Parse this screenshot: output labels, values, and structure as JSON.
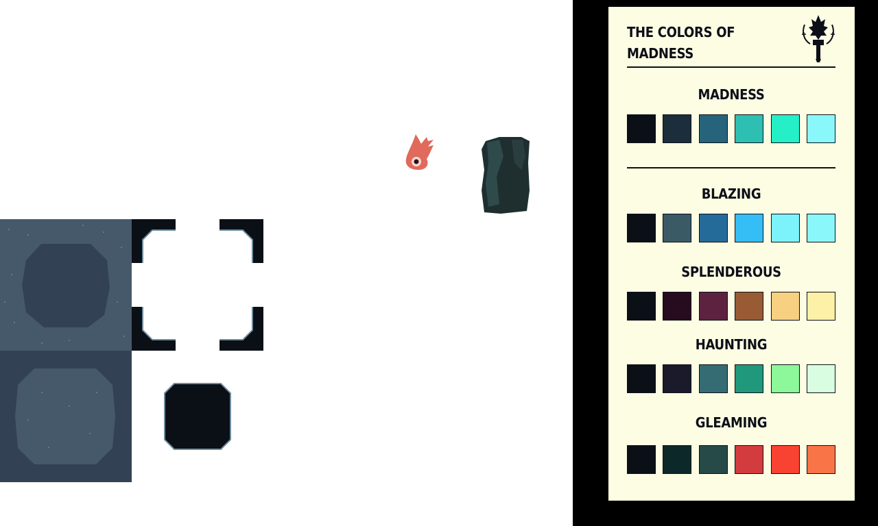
{
  "card": {
    "title": "THE COLORS OF\nMADNESS",
    "emblem_icon": "torch-emblem-icon"
  },
  "palettes": [
    {
      "name": "MADNESS",
      "colors": [
        "#0b0f16",
        "#1c2e3b",
        "#26647c",
        "#2ebfb3",
        "#24efc7",
        "#8af7fb"
      ]
    },
    {
      "name": "BLAZING",
      "colors": [
        "#0b0f16",
        "#3a5a66",
        "#256b9a",
        "#35bdf5",
        "#7cf2fb",
        "#8af7fb"
      ]
    },
    {
      "name": "SPLENDEROUS",
      "colors": [
        "#0b0f16",
        "#260c1e",
        "#5c2240",
        "#985b34",
        "#f8d082",
        "#fdf1a8"
      ]
    },
    {
      "name": "HAUNTING",
      "colors": [
        "#0b0f16",
        "#1b1a2a",
        "#356c74",
        "#1f987c",
        "#8cf899",
        "#d9fde1"
      ]
    },
    {
      "name": "GLEAMING",
      "colors": [
        "#0b0f16",
        "#0d2828",
        "#254a48",
        "#d23c3f",
        "#f94332",
        "#f97446"
      ]
    }
  ],
  "sprites": {
    "floor_tile_top_color": "#46596b",
    "floor_tile_bottom_color": "#334154",
    "wall_corner_color": "#0b0f16",
    "rock_color": "#1f2f30",
    "creature_color": "#e06a5c",
    "creature_icon": "eye-creature-icon",
    "rock_icon": "rock-pillar-icon",
    "pit_icon": "pit-tile-icon"
  }
}
